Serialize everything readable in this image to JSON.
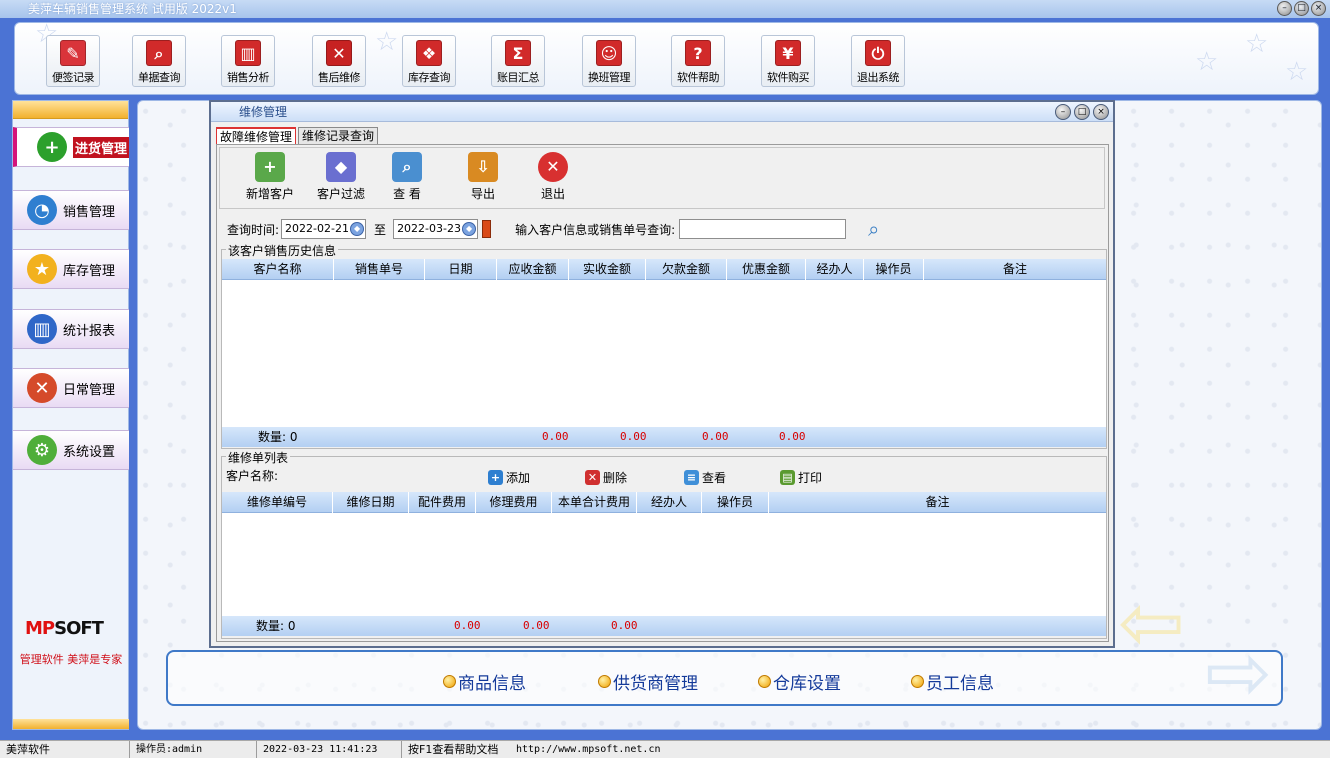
{
  "app": {
    "title": "美萍车辆销售管理系统 试用版 2022v1",
    "window_buttons": [
      "–",
      "□",
      "×"
    ]
  },
  "toolbar": {
    "buttons": [
      {
        "label": "便签记录",
        "icon": "memo-icon",
        "color": "#d9343a",
        "glyph": "✎"
      },
      {
        "label": "单据查询",
        "icon": "magnifier-icon",
        "color": "#d12a2a",
        "glyph": "⌕"
      },
      {
        "label": "销售分析",
        "icon": "bar-chart-icon",
        "color": "#d12a2a",
        "glyph": "▥"
      },
      {
        "label": "售后维修",
        "icon": "wrench-icon",
        "color": "#c72222",
        "glyph": "✕"
      },
      {
        "label": "库存查询",
        "icon": "boxes-icon",
        "color": "#d12a2a",
        "glyph": "❖"
      },
      {
        "label": "账目汇总",
        "icon": "sigma-icon",
        "color": "#d12a2a",
        "glyph": "Σ"
      },
      {
        "label": "换班管理",
        "icon": "users-icon",
        "color": "#d12a2a",
        "glyph": "☺"
      },
      {
        "label": "软件帮助",
        "icon": "help-icon",
        "color": "#d12a2a",
        "glyph": "?"
      },
      {
        "label": "软件购买",
        "icon": "yen-icon",
        "color": "#d12a2a",
        "glyph": "¥"
      },
      {
        "label": "退出系统",
        "icon": "power-icon",
        "color": "#d12a2a",
        "glyph": "⏻"
      }
    ]
  },
  "sidebar": {
    "items": [
      {
        "label": "进货管理",
        "icon": "plus-icon",
        "glyph": "+",
        "color": "#2ca02c",
        "active": true
      },
      {
        "label": "销售管理",
        "icon": "pie-chart-icon",
        "glyph": "◔",
        "color": "#2f7fd0",
        "active": false
      },
      {
        "label": "库存管理",
        "icon": "star-icon",
        "glyph": "★",
        "color": "#f2b11e",
        "active": false
      },
      {
        "label": "统计报表",
        "icon": "report-bars-icon",
        "glyph": "▥",
        "color": "#2f67c8",
        "active": false
      },
      {
        "label": "日常管理",
        "icon": "tools-icon",
        "glyph": "✕",
        "color": "#d54a2a",
        "active": false
      },
      {
        "label": "系统设置",
        "icon": "gear-icon",
        "glyph": "⚙",
        "color": "#4fae3a",
        "active": false
      }
    ],
    "logo_text_1": "MP",
    "logo_text_2": "SOFT",
    "slogan": "管理软件 美萍是专家"
  },
  "repair_window": {
    "title": "维修管理",
    "tabs": [
      "故障维修管理",
      "维修记录查询"
    ],
    "actions": [
      {
        "label": "新增客户",
        "icon": "add-customer-icon",
        "glyph": "+",
        "color": "#5aa84a"
      },
      {
        "label": "客户过滤",
        "icon": "filter-icon",
        "glyph": "◆",
        "color": "#6a6fd0"
      },
      {
        "label": "查  看",
        "icon": "view-icon",
        "glyph": "⌕",
        "color": "#4a8fd0"
      },
      {
        "label": "导出",
        "icon": "export-icon",
        "glyph": "⇩",
        "color": "#d98a22"
      },
      {
        "label": "退出",
        "icon": "exit-icon",
        "glyph": "✕",
        "color": "#d83030"
      }
    ],
    "query": {
      "label_time": "查询时间:",
      "date_from": "2022-02-21",
      "to": "至",
      "date_to": "2022-03-23",
      "label_search": "输入客户信息或销售单号查询:",
      "search_value": ""
    },
    "sales_history": {
      "title": "该客户销售历史信息",
      "columns": [
        "客户名称",
        "销售单号",
        "日期",
        "应收金额",
        "实收金额",
        "欠款金额",
        "优惠金额",
        "经办人",
        "操作员",
        "备注"
      ],
      "rows": [],
      "footer": {
        "count_label": "数量: 0",
        "receivable": "0.00",
        "received": "0.00",
        "debt": "0.00",
        "discount": "0.00"
      }
    },
    "repair_list": {
      "title": "维修单列表",
      "customer_label": "客户名称:",
      "buttons": [
        {
          "label": "添加",
          "icon": "add-icon",
          "glyph": "+",
          "color": "#2e7fd0"
        },
        {
          "label": "删除",
          "icon": "delete-icon",
          "glyph": "✕",
          "color": "#d03030"
        },
        {
          "label": "查看",
          "icon": "view-doc-icon",
          "glyph": "≡",
          "color": "#3f8fd8"
        },
        {
          "label": "打印",
          "icon": "print-icon",
          "glyph": "▤",
          "color": "#5a9a30"
        }
      ],
      "columns": [
        "维修单编号",
        "维修日期",
        "配件费用",
        "修理费用",
        "本单合计费用",
        "经办人",
        "操作员",
        "备注"
      ],
      "rows": [],
      "footer": {
        "count_label": "数量: 0",
        "parts": "0.00",
        "repair": "0.00",
        "total": "0.00"
      }
    }
  },
  "quick_links": [
    "商品信息",
    "供货商管理",
    "仓库设置",
    "员工信息"
  ],
  "statusbar": {
    "company": "美萍软件",
    "operator": "操作员:admin",
    "datetime": "2022-03-23 11:41:23",
    "help": "按F1查看帮助文档",
    "url": "http://www.mpsoft.net.cn"
  }
}
